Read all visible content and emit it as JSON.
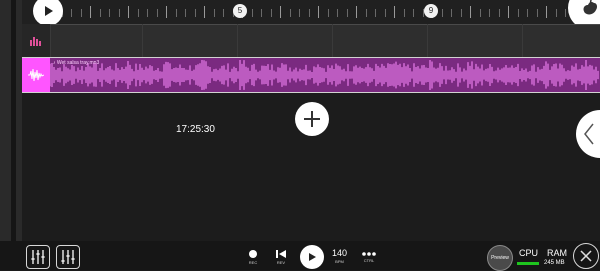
{
  "timeline": {
    "marker_1": "5",
    "marker_2": "9"
  },
  "track_audio": {
    "clip_name": "♪ Wet salsa tray.mp3"
  },
  "main": {
    "clock": "17:25:30"
  },
  "transport": {
    "rec_label": "REC",
    "rew_label": "REV",
    "bpm_value": "140",
    "bpm_label": "BPM",
    "ctrl_label": "CTRL"
  },
  "status": {
    "preview_label": "Preview",
    "cpu_label": "CPU",
    "ram_label": "RAM",
    "ram_value": "245 MB"
  },
  "icons": {
    "play": "play-icon",
    "add": "plus-icon",
    "logo": "fruit-logo-icon",
    "side": "chevron-left-icon",
    "mixer": "mixer-icon",
    "piano": "piano-icon",
    "rec": "record-dot-icon",
    "rew": "rewind-icon",
    "ctrl": "dots-icon",
    "close": "close-icon",
    "bars": "bars-icon",
    "wave": "waveform-icon"
  },
  "colors": {
    "audio_track": "#7a2a80",
    "audio_head": "#ff55ff",
    "cpu_bar": "#1ec41e"
  }
}
